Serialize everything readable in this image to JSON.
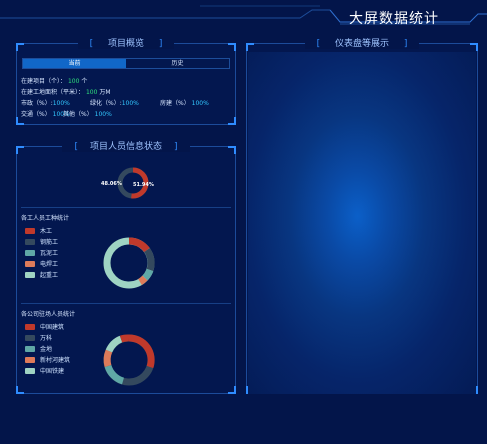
{
  "header": {
    "title": "大屏数据统计"
  },
  "overview": {
    "title": "项目概览",
    "tabs": [
      {
        "label": "当前"
      },
      {
        "label": "历史"
      }
    ],
    "line1": {
      "label": "在建项目（个）：",
      "value": "100",
      "unit": "个"
    },
    "line2": {
      "label": "在建工地面积（平米）：",
      "value": "100",
      "unit": "万M"
    },
    "line3": [
      {
        "label": "市政（%）:",
        "value": "100%"
      },
      {
        "label": "绿化（%）:",
        "value": "100%"
      },
      {
        "label": "房建（%）",
        "value": "100%"
      }
    ],
    "line4": [
      {
        "label": "交通（%）",
        "value": "100%"
      },
      {
        "label": "其他（%）",
        "value": "100%"
      }
    ]
  },
  "personnel": {
    "title": "项目人员信息状态",
    "ratio": {
      "left_label": "48.06%",
      "right_label": "51.94%"
    },
    "worktype": {
      "title": "各工人员工种统计",
      "items": [
        "木工",
        "钢筋工",
        "瓦泥工",
        "电焊工",
        "起重工"
      ]
    },
    "company": {
      "title": "各公司驻场人员统计",
      "items": [
        "中国建筑",
        "万科",
        "金地",
        "新村河建筑",
        "中国铁建"
      ]
    }
  },
  "dashboard": {
    "title": "仪表盘等展示"
  },
  "colors": {
    "red": "#c0392b",
    "slate": "#34495e",
    "teal": "#5fa8a6",
    "salmon": "#dd7b5a",
    "mint": "#9fd4c3",
    "accent": "#2f8cff",
    "green": "#2fe07c",
    "cyan": "#33c8ff"
  }
}
